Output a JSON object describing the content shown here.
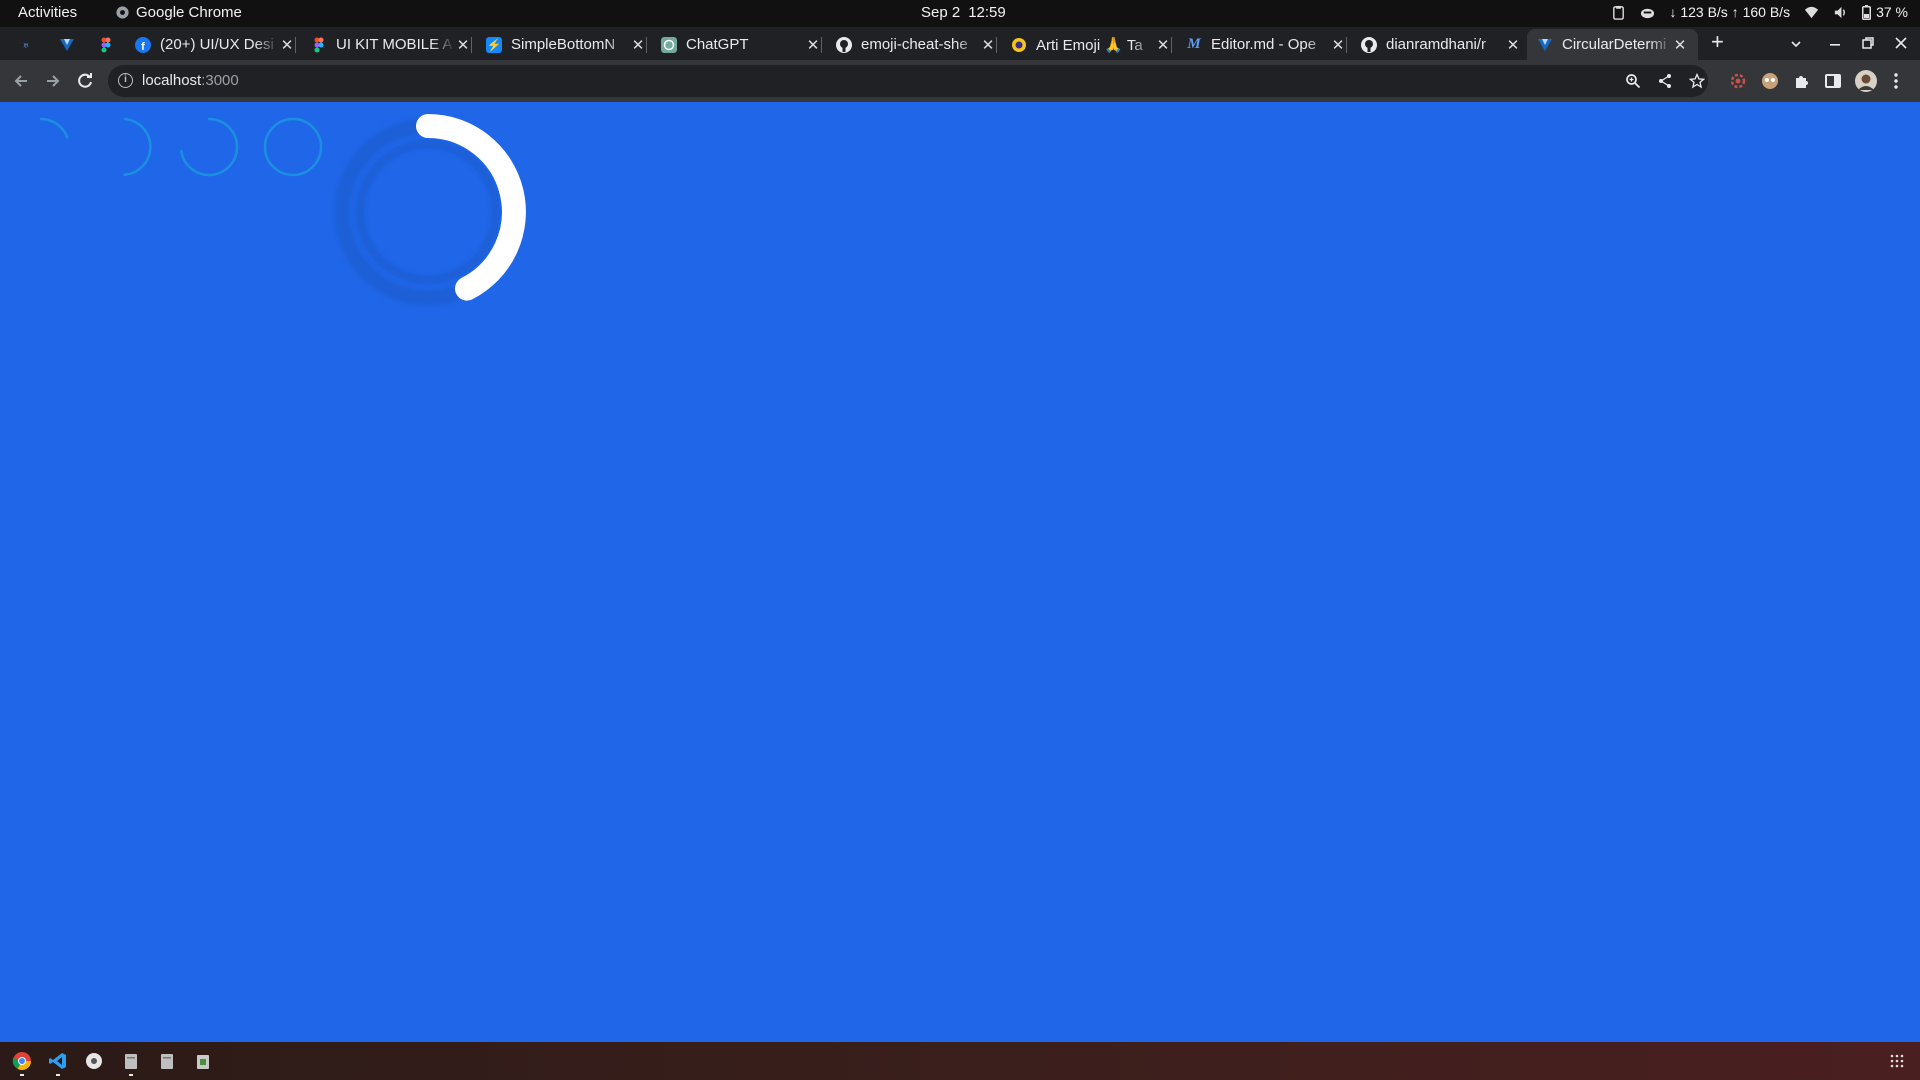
{
  "topbar": {
    "activities": "Activities",
    "app_name": "Google Chrome",
    "date": "Sep 2",
    "time": "12:59",
    "network_down": "↓ 123 B/s",
    "network_up": "↑ 160 B/s",
    "battery": "37 %"
  },
  "tabs": [
    {
      "title": "",
      "favicon": "app-icon",
      "pinned": true
    },
    {
      "title": "",
      "favicon": "vuetify-icon",
      "pinned": true
    },
    {
      "title": "",
      "favicon": "figma-icon",
      "pinned": true
    },
    {
      "title": "(20+) UI/UX Desi",
      "favicon": "facebook-icon"
    },
    {
      "title": "UI KIT MOBILE A",
      "favicon": "figma-icon"
    },
    {
      "title": "SimpleBottomN",
      "favicon": "stackblitz-icon"
    },
    {
      "title": "ChatGPT",
      "favicon": "chatgpt-icon"
    },
    {
      "title": "emoji-cheat-she",
      "favicon": "github-icon"
    },
    {
      "title": "Arti Emoji 🙏 Ta",
      "favicon": "emoji-site-icon"
    },
    {
      "title": "Editor.md - Ope",
      "favicon": "editor-md-icon"
    },
    {
      "title": "dianramdhani/r",
      "favicon": "github-icon"
    },
    {
      "title": "CircularDetermi",
      "favicon": "vuetify-icon",
      "active": true
    }
  ],
  "toolbar": {
    "url_host": "localhost",
    "url_port": ":3000"
  },
  "page": {
    "background": "#2066e8",
    "spinner_color": "#ffffff",
    "track_color": "#1d5fd6"
  },
  "dock": {
    "items": [
      "chrome-icon",
      "vscode-icon",
      "disc-icon",
      "files-icon",
      "files-icon",
      "trash-icon"
    ]
  }
}
